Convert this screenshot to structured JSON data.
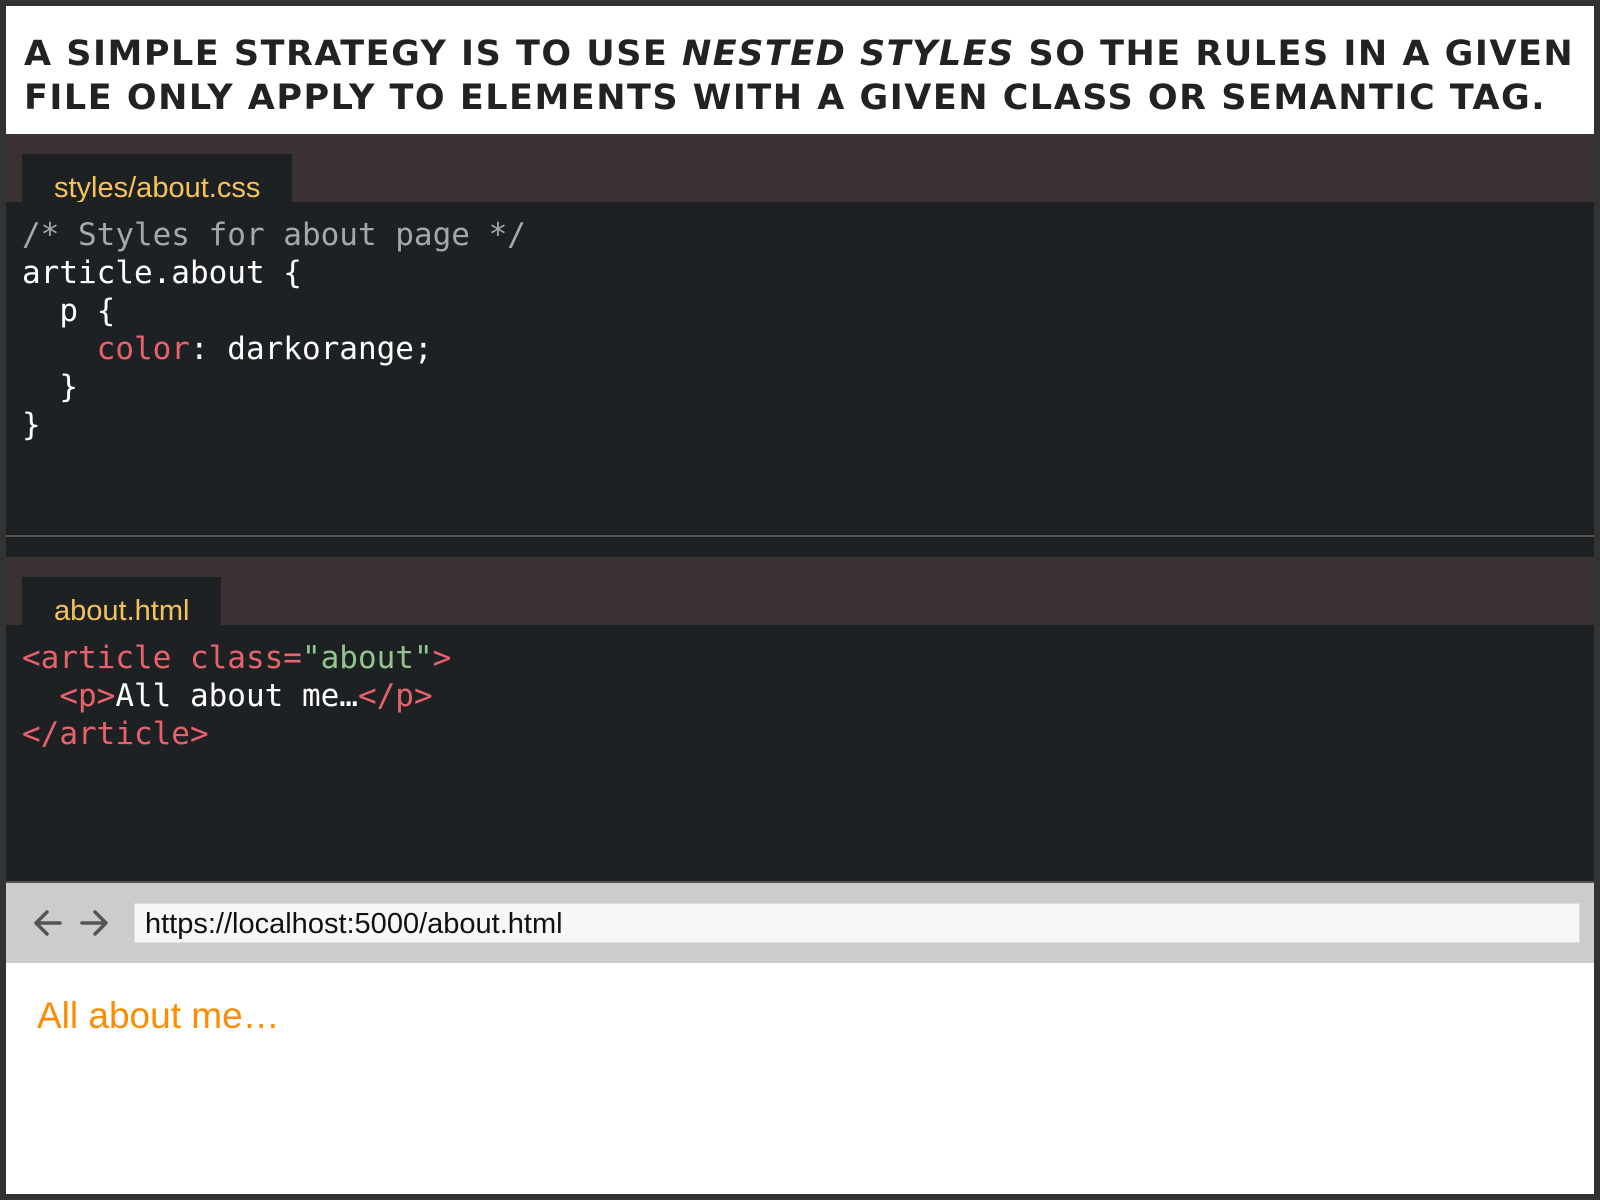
{
  "caption": {
    "before": "A simple strategy is to use ",
    "emphasis": "nested styles",
    "after": " so the rules in a given file only apply to elements with a given class or semantic tag."
  },
  "css_panel": {
    "tab_label": "styles/about.css",
    "lines": {
      "comment": "/* Styles for about page */",
      "selector": "article.about {",
      "nested_selector": "  p {",
      "indent": "    ",
      "property": "color",
      "value": ": darkorange;",
      "close_inner": "  }",
      "close_outer": "}"
    }
  },
  "html_panel": {
    "tab_label": "about.html",
    "lines": {
      "open_article": "<article class=",
      "class_value": "\"about\"",
      "open_article_end": ">",
      "indent": "  ",
      "open_p": "<p>",
      "p_text": "All about me…",
      "close_p": "</p>",
      "close_article": "</article>"
    }
  },
  "browser": {
    "back_icon": "arrow-left-icon",
    "forward_icon": "arrow-right-icon",
    "url": "https://localhost:5000/about.html",
    "page_text": "All about me…",
    "page_text_color": "#ff8c00"
  },
  "colors": {
    "tab_label": "#f5c35a",
    "code_background": "#1e2124",
    "tab_strip": "#3a3232",
    "syntax_keyword": "#e8626b",
    "syntax_string": "#93c48b",
    "syntax_comment": "#a3a8b0"
  }
}
